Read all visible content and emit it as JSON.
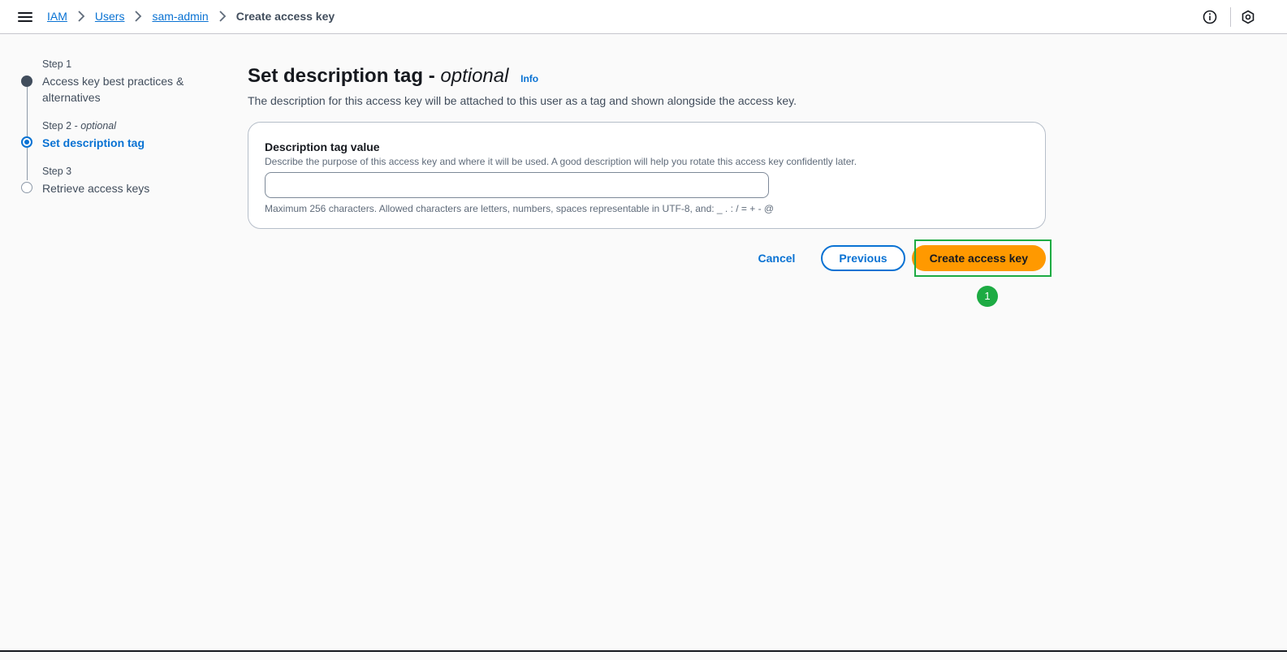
{
  "breadcrumb": {
    "items": [
      "IAM",
      "Users",
      "sam-admin"
    ],
    "current": "Create access key"
  },
  "steps": [
    {
      "label": "Step 1",
      "label_suffix": "",
      "title": "Access key best practices & alternatives",
      "state": "done"
    },
    {
      "label": "Step 2 - ",
      "label_suffix": "optional",
      "title": "Set description tag",
      "state": "active"
    },
    {
      "label": "Step 3",
      "label_suffix": "",
      "title": "Retrieve access keys",
      "state": "todo"
    }
  ],
  "main": {
    "title": "Set description tag - ",
    "title_optional": "optional",
    "info_link": "Info",
    "description": "The description for this access key will be attached to this user as a tag and shown alongside the access key."
  },
  "field": {
    "label": "Description tag value",
    "description": "Describe the purpose of this access key and where it will be used. A good description will help you rotate this access key confidently later.",
    "value": "",
    "hint": "Maximum 256 characters. Allowed characters are letters, numbers, spaces representable in UTF-8, and: _ . : / = + - @"
  },
  "actions": {
    "cancel": "Cancel",
    "previous": "Previous",
    "create": "Create access key"
  },
  "annotation": {
    "badge": "1",
    "color": "#1dab43"
  },
  "colors": {
    "accent": "#0972d3",
    "primary_button": "#ff9900"
  },
  "icons": [
    "menu-icon",
    "chevron-right-icon",
    "info-circle-icon",
    "settings-hexagon-icon"
  ]
}
